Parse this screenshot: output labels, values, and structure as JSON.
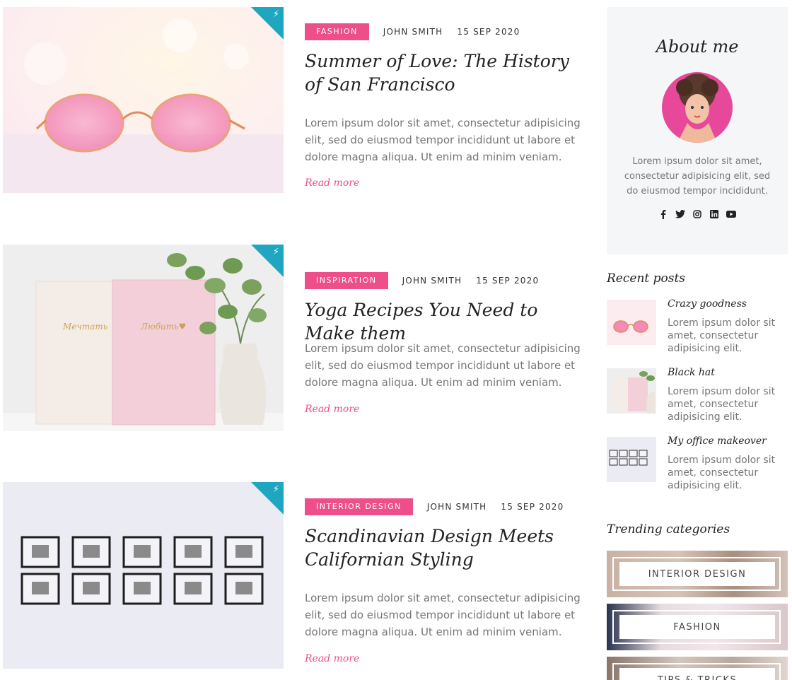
{
  "posts": [
    {
      "category": "FASHION",
      "author": "JOHN SMITH",
      "date": "15 SEP 2020",
      "title": "Summer of Love: The History of San Francisco",
      "excerpt": "Lorem ipsum dolor sit amet, consectetur adipisicing elit, sed do eiusmod tempor incididunt ut labore et dolore magna aliqua. Ut enim ad minim veniam.",
      "read_more": "Read more",
      "image_icon": "glasses-photo"
    },
    {
      "category": "INSPIRATION",
      "author": "JOHN SMITH",
      "date": "15 SEP 2020",
      "title": "Yoga Recipes You Need to Make them",
      "excerpt": "Lorem ipsum dolor sit amet, consectetur adipisicing elit, sed do eiusmod tempor incididunt ut labore et dolore magna aliqua. Ut enim ad minim veniam.",
      "read_more": "Read more",
      "image_icon": "notebooks-plant-photo"
    },
    {
      "category": "INTERIOR DESIGN",
      "author": "JOHN SMITH",
      "date": "15 SEP 2020",
      "title": "Scandinavian Design Meets Californian Styling",
      "excerpt": "Lorem ipsum dolor sit amet, consectetur adipisicing elit, sed do eiusmod tempor incididunt ut labore et dolore magna aliqua. Ut enim ad minim veniam.",
      "read_more": "Read more",
      "image_icon": "picture-frames-photo"
    }
  ],
  "about": {
    "title": "About me",
    "text": "Lorem ipsum dolor sit amet, consectetur adipisicing elit, sed do eiusmod tempor incididunt.",
    "socials": [
      "facebook-icon",
      "twitter-icon",
      "instagram-icon",
      "linkedin-icon",
      "youtube-icon"
    ]
  },
  "recent_posts": {
    "heading": "Recent posts",
    "items": [
      {
        "title": "Crazy goodness",
        "text": "Lorem ipsum dolor sit amet, consectetur adipisicing elit."
      },
      {
        "title": "Black hat",
        "text": "Lorem ipsum dolor sit amet, consectetur adipisicing elit."
      },
      {
        "title": "My office makeover",
        "text": "Lorem ipsum dolor sit amet, consectetur adipisicing elit."
      }
    ]
  },
  "trending": {
    "heading": "Trending categories",
    "items": [
      {
        "label": "INTERIOR DESIGN"
      },
      {
        "label": "FASHION"
      },
      {
        "label": "TIPS & TRICKS"
      }
    ]
  },
  "colors": {
    "accent": "#ee4f8a",
    "corner": "#1fa6c0",
    "sidebar_bg": "#f5f6f8"
  }
}
